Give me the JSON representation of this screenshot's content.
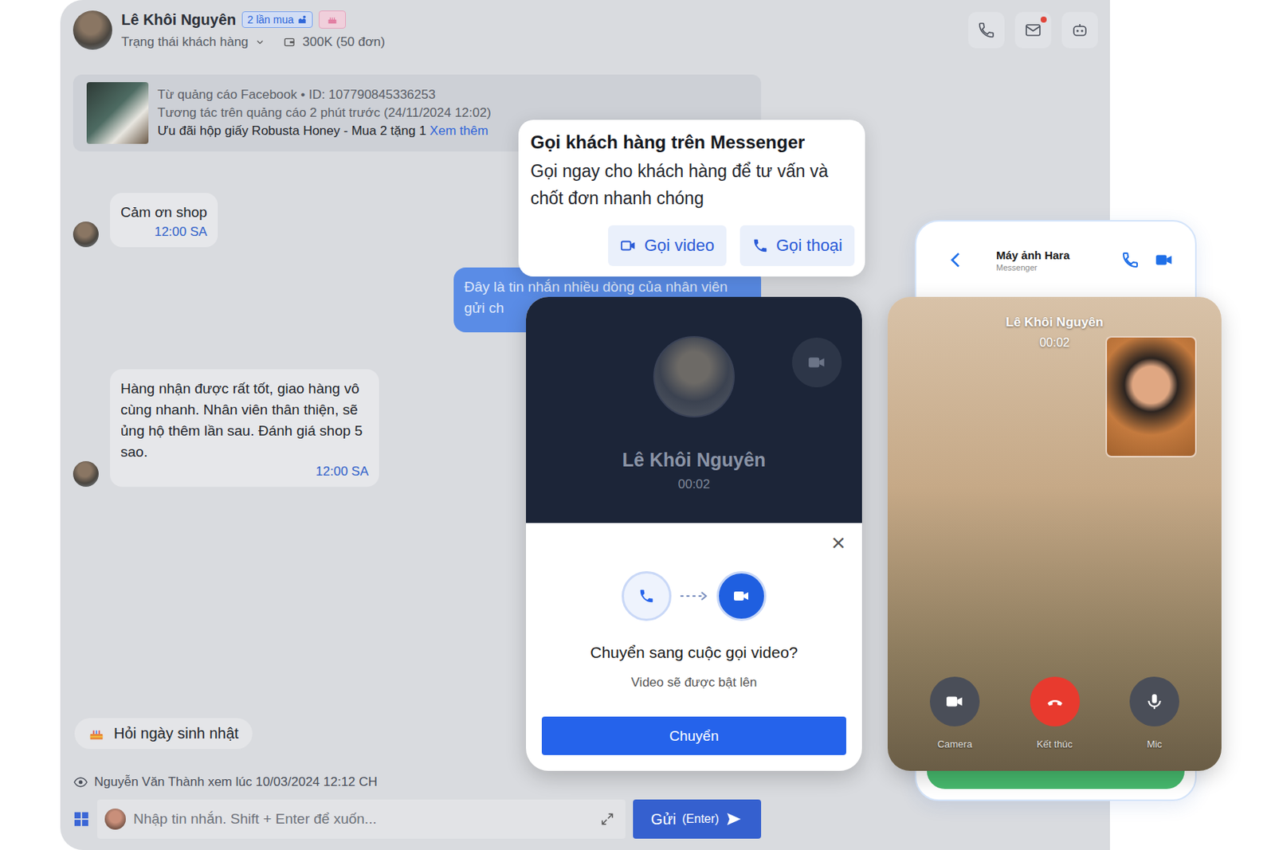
{
  "header": {
    "name": "Lê Khôi Nguyên",
    "purchase_badge": "2 lần mua",
    "status_label": "Trạng thái khách hàng",
    "spend": "300K (50 đơn)",
    "mail_unread": true
  },
  "ad": {
    "source": "Từ quảng cáo Facebook • ID: 107790845336253",
    "interaction": "Tương tác trên quảng cáo 2 phút trước (24/11/2024 12:02)",
    "title": "Ưu đãi hộp giấy Robusta Honey - Mua 2 tặng 1",
    "more": "Xem thêm"
  },
  "messages": [
    {
      "kind": "incoming",
      "text": "Cảm ơn shop",
      "time": "12:00 SA"
    },
    {
      "kind": "outgoing",
      "text": "Đây là tin nhắn nhiều dòng của nhân viên gửi ch"
    },
    {
      "kind": "incoming",
      "text": "Hàng nhận được rất tốt, giao hàng vô cùng nhanh. Nhân viên thân thiện, sẽ ủng hộ thêm lần sau. Đánh giá shop 5 sao.",
      "time": "12:00 SA"
    }
  ],
  "quick_reply": "Hỏi ngày sinh nhật",
  "seen": "Nguyễn Văn Thành xem lúc 10/03/2024 12:12 CH",
  "composer": {
    "placeholder": "Nhập tin nhắn. Shift + Enter để xuốn...",
    "send": "Gửi",
    "send_hint": "(Enter)"
  },
  "call_tooltip": {
    "title": "Gọi khách hàng trên Messenger",
    "description": "Gọi ngay cho khách hàng để tư vấn và chốt đơn nhanh chóng",
    "buttons": [
      {
        "label": "Gọi video",
        "kind": "video"
      },
      {
        "label": "Gọi thoại",
        "kind": "voice"
      }
    ]
  },
  "call_window": {
    "name": "Lê Khôi Nguyên",
    "duration": "00:02",
    "camera_on": false
  },
  "switch_dialog": {
    "title": "Chuyển sang cuộc gọi video?",
    "subtitle": "Video sẽ được bật lên",
    "button": "Chuyển",
    "close": "×"
  },
  "phone": {
    "contact": "Máy ảnh Hara",
    "platform": "Messenger",
    "caller": "Lê Khôi Nguyên",
    "duration": "00:02",
    "controls": [
      {
        "label": "Camera",
        "kind": "camera"
      },
      {
        "label": "Kết thúc",
        "kind": "end"
      },
      {
        "label": "Mic",
        "kind": "mic"
      }
    ]
  }
}
